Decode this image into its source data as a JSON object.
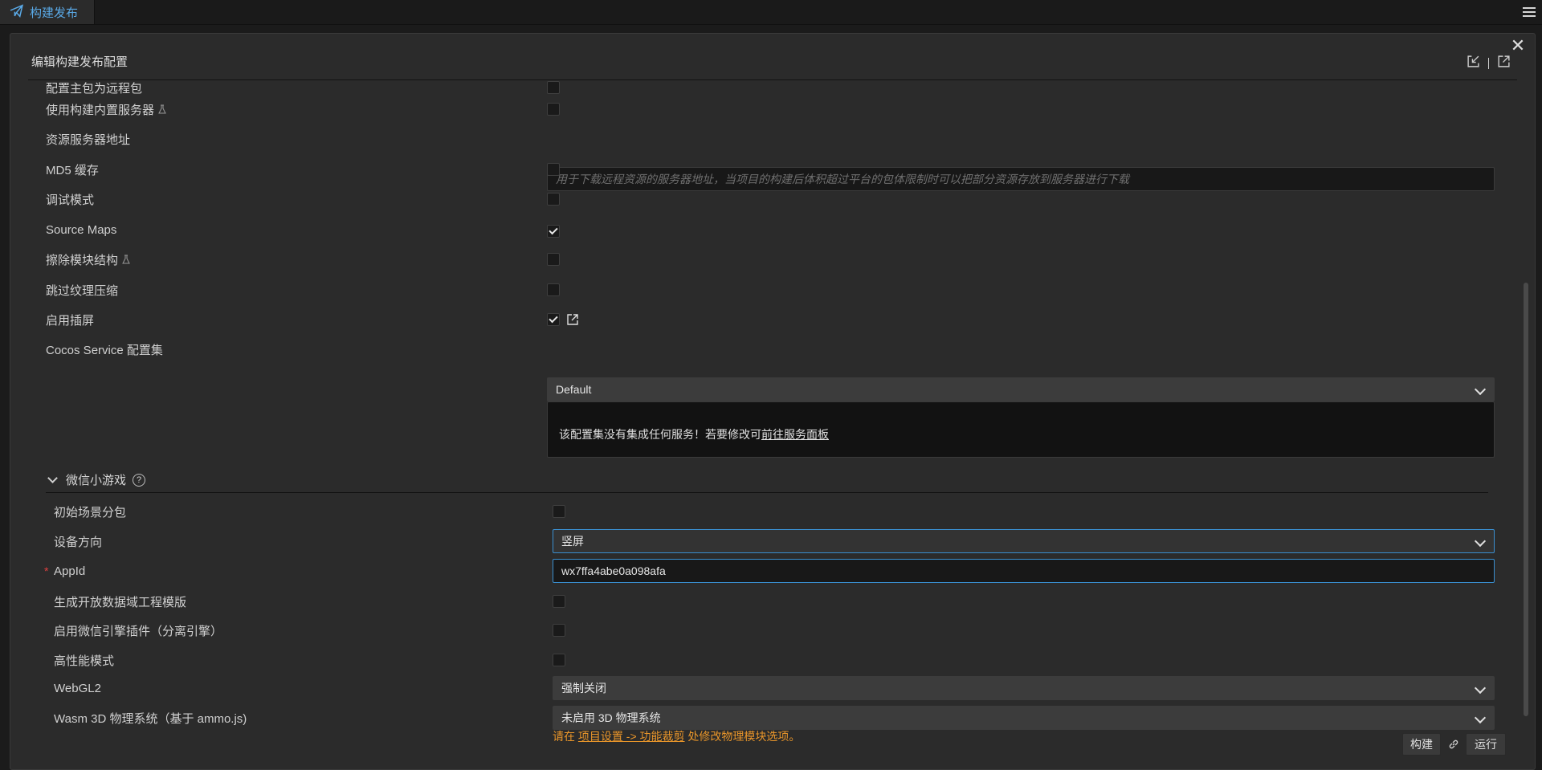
{
  "tab": {
    "title": "构建发布"
  },
  "panel": {
    "title": "编辑构建发布配置"
  },
  "rows": {
    "cut_off": "配置主包为远程包",
    "builtin_server": "使用构建内置服务器",
    "resource_server": "资源服务器地址",
    "resource_server_placeholder": "用于下载远程资源的服务器地址，当项目的构建后体积超过平台的包体限制时可以把部分资源存放到服务器进行下载",
    "md5": "MD5 缓存",
    "debug": "调试模式",
    "source_maps": "Source Maps",
    "erase_modules": "擦除模块结构",
    "skip_texture": "跳过纹理压缩",
    "splash": "启用插屏",
    "cocos_service": "Cocos Service 配置集",
    "cocos_service_value": "Default",
    "info_text": "该配置集没有集成任何服务！若要修改可",
    "info_link": "前往服务面板"
  },
  "checks": {
    "builtin_server": false,
    "md5": false,
    "debug": false,
    "source_maps": true,
    "erase_modules": false,
    "skip_texture": false,
    "splash": true
  },
  "wechat": {
    "section_title": "微信小游戏",
    "initial_subpackage": "初始场景分包",
    "initial_subpackage_checked": false,
    "orientation": "设备方向",
    "orientation_value": "竖屏",
    "appid_label": "AppId",
    "appid_value": "wx7ffa4abe0a098afa",
    "open_data": "生成开放数据域工程模版",
    "open_data_checked": false,
    "engine_plugin": "启用微信引擎插件（分离引擎）",
    "engine_plugin_checked": false,
    "high_perf": "高性能模式",
    "high_perf_checked": false,
    "webgl2": "WebGL2",
    "webgl2_value": "强制关闭",
    "wasm": "Wasm 3D 物理系统（基于 ammo.js)",
    "wasm_value": "未启用 3D 物理系统",
    "warn_prefix": "请在",
    "warn_link": "项目设置 -> 功能裁剪",
    "warn_suffix": "处修改物理模块选项。"
  },
  "footer": {
    "build": "构建",
    "run": "运行"
  },
  "colors": {
    "accent": "#3a8fd0",
    "warning": "#e8952a",
    "tab_text": "#5aa9e6"
  }
}
